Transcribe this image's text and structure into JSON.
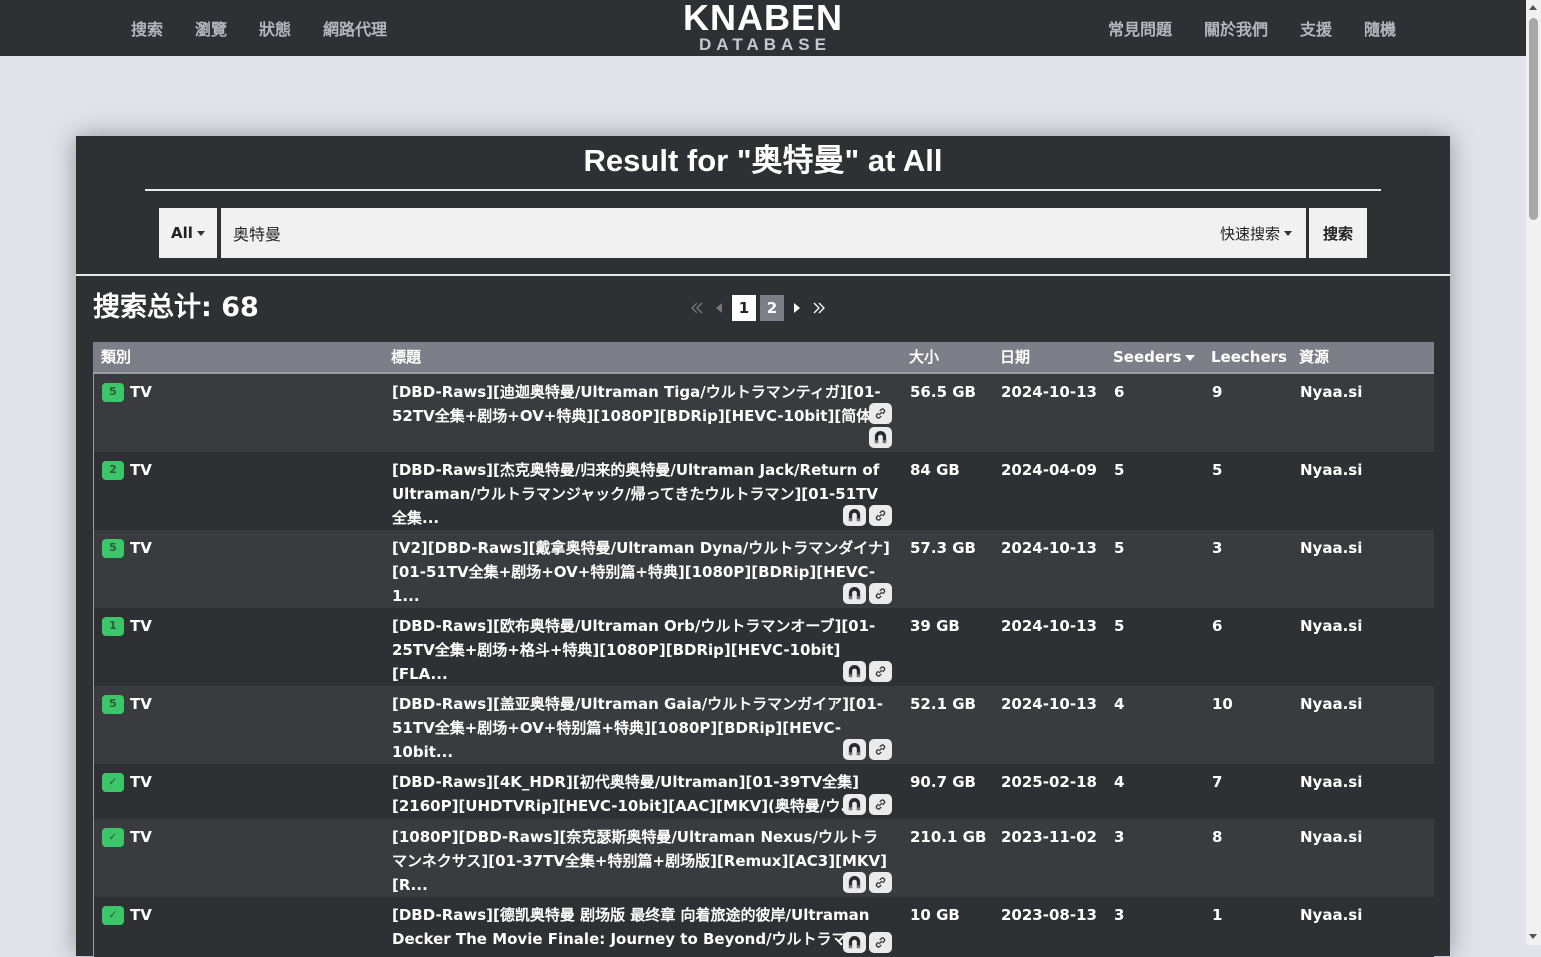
{
  "nav": {
    "left": [
      "搜索",
      "瀏覽",
      "狀態",
      "網路代理"
    ],
    "right": [
      "常見問題",
      "關於我們",
      "支援",
      "隨機"
    ],
    "logo_top": "KNABEN",
    "logo_bottom": "DATABASE"
  },
  "results": {
    "title": "Result for \"奥特曼\" at All",
    "category_label": "All",
    "query": "奥特曼",
    "quick_search_label": "快速搜索",
    "search_button": "搜索",
    "total_label": "搜索总计: 68",
    "pagination": {
      "pages": [
        "1",
        "2"
      ],
      "current": "1"
    }
  },
  "table": {
    "headers": {
      "category": "類別",
      "title": "標題",
      "size": "大小",
      "date": "日期",
      "seeders": "Seeders",
      "leechers": "Leechers",
      "source": "資源"
    },
    "rows": [
      {
        "badge": "5",
        "category": "TV",
        "title": "[DBD-Raws][迪迦奥特曼/Ultraman Tiga/ウルトラマンティガ][01-52TV全集+剧场+OV+特典][1080P][BDRip][HEVC-10bit][简体...",
        "size": "56.5 GB",
        "date": "2024-10-13",
        "seeders": "6",
        "leechers": "9",
        "source": "Nyaa.si"
      },
      {
        "badge": "2",
        "category": "TV",
        "title": "[DBD-Raws][杰克奥特曼/归来的奥特曼/Ultraman Jack/Return of Ultraman/ウルトラマンジャック/帰ってきたウルトラマン][01-51TV全集...",
        "size": "84 GB",
        "date": "2024-04-09",
        "seeders": "5",
        "leechers": "5",
        "source": "Nyaa.si"
      },
      {
        "badge": "5",
        "category": "TV",
        "title": "[V2][DBD-Raws][戴拿奥特曼/Ultraman Dyna/ウルトラマンダイナ][01-51TV全集+剧场+OV+特别篇+特典][1080P][BDRip][HEVC-1...",
        "size": "57.3 GB",
        "date": "2024-10-13",
        "seeders": "5",
        "leechers": "3",
        "source": "Nyaa.si"
      },
      {
        "badge": "1",
        "category": "TV",
        "title": "[DBD-Raws][欧布奥特曼/Ultraman Orb/ウルトラマンオーブ][01-25TV全集+剧场+格斗+特典][1080P][BDRip][HEVC-10bit][FLA...",
        "size": "39 GB",
        "date": "2024-10-13",
        "seeders": "5",
        "leechers": "6",
        "source": "Nyaa.si"
      },
      {
        "badge": "5",
        "category": "TV",
        "title": "[DBD-Raws][盖亚奥特曼/Ultraman Gaia/ウルトラマンガイア][01-51TV全集+剧场+OV+特别篇+特典][1080P][BDRip][HEVC-10bit...",
        "size": "52.1 GB",
        "date": "2024-10-13",
        "seeders": "4",
        "leechers": "10",
        "source": "Nyaa.si"
      },
      {
        "badge": "✓",
        "category": "TV",
        "title": "[DBD-Raws][4K_HDR][初代奥特曼/Ultraman][01-39TV全集][2160P][UHDTVRip][HEVC-10bit][AAC][MKV](奥特曼/ウ...",
        "size": "90.7 GB",
        "date": "2025-02-18",
        "seeders": "4",
        "leechers": "7",
        "source": "Nyaa.si"
      },
      {
        "badge": "✓",
        "category": "TV",
        "title": "[1080P][DBD-Raws][奈克瑟斯奥特曼/Ultraman Nexus/ウルトラマンネクサス][01-37TV全集+特别篇+剧场版][Remux][AC3][MKV][R...",
        "size": "210.1 GB",
        "date": "2023-11-02",
        "seeders": "3",
        "leechers": "8",
        "source": "Nyaa.si"
      },
      {
        "badge": "✓",
        "category": "TV",
        "title": "[DBD-Raws][德凯奥特曼 剧场版 最终章 向着旅途的彼岸/Ultraman Decker The Movie Finale: Journey to Beyond/ウルトラマ...",
        "size": "10 GB",
        "date": "2023-08-13",
        "seeders": "3",
        "leechers": "1",
        "source": "Nyaa.si"
      }
    ]
  },
  "icons": {
    "magnet": "magnet-icon",
    "link": "link-icon"
  },
  "colors": {
    "badge": "#3cc66a",
    "accent_line": "#59c08a",
    "panel": "#2f3033"
  }
}
